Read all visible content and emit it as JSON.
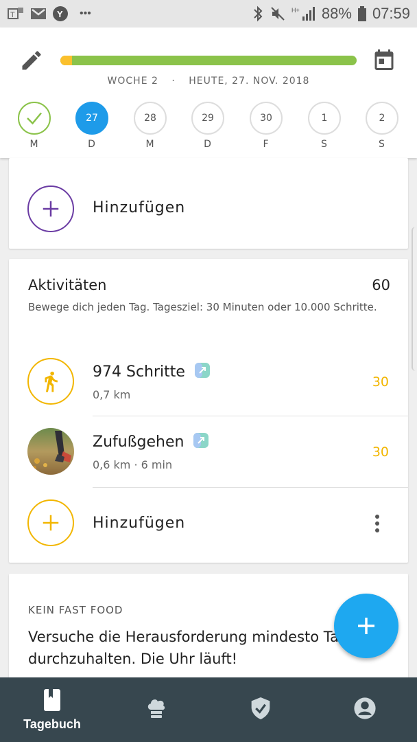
{
  "status_bar": {
    "battery": "88%",
    "time": "07:59",
    "more": "•••",
    "left_icons": [
      "teams-icon",
      "gmail-icon",
      "yahoo-icon"
    ],
    "right_icons": [
      "bluetooth-icon",
      "mute-icon",
      "signal-icon",
      "battery-icon"
    ]
  },
  "header": {
    "week": "WOCHE 2",
    "separator": "·",
    "today": "HEUTE, 27. NOV. 2018",
    "progress_fraction": 0.04,
    "colors": {
      "progress": "#8bc34a",
      "progress_start": "#fbc02d",
      "today": "#1e9be9"
    },
    "days": [
      {
        "num": "",
        "letter": "M",
        "state": "done"
      },
      {
        "num": "27",
        "letter": "D",
        "state": "today"
      },
      {
        "num": "28",
        "letter": "M",
        "state": "future"
      },
      {
        "num": "29",
        "letter": "D",
        "state": "future"
      },
      {
        "num": "30",
        "letter": "F",
        "state": "future"
      },
      {
        "num": "1",
        "letter": "S",
        "state": "future"
      },
      {
        "num": "2",
        "letter": "S",
        "state": "future"
      }
    ]
  },
  "add_card": {
    "label": "Hinzufügen",
    "color": "#6a3ba3"
  },
  "activities": {
    "title": "Aktivitäten",
    "score": "60",
    "description": "Bewege dich jeden Tag. Tagesziel: 30 Minuten oder 10.000 Schritte.",
    "items": [
      {
        "name": "974 Schritte",
        "detail": "0,7 km",
        "points": "30"
      },
      {
        "name": "Zufußgehen",
        "detail": "0,6 km · 6 min",
        "points": "30"
      }
    ],
    "add_label": "Hinzufügen",
    "accent": "#f2b600"
  },
  "challenge": {
    "label": "KEIN FAST FOOD",
    "text": "Versuche die Herausforderung mindesto Tage durchzuhalten. Die Uhr läuft!"
  },
  "bottom_nav": {
    "items": [
      {
        "label": "Tagebuch",
        "icon": "diary-icon"
      },
      {
        "label": "",
        "icon": "chef-hat-icon"
      },
      {
        "label": "",
        "icon": "shield-check-icon"
      },
      {
        "label": "",
        "icon": "profile-icon"
      }
    ]
  }
}
